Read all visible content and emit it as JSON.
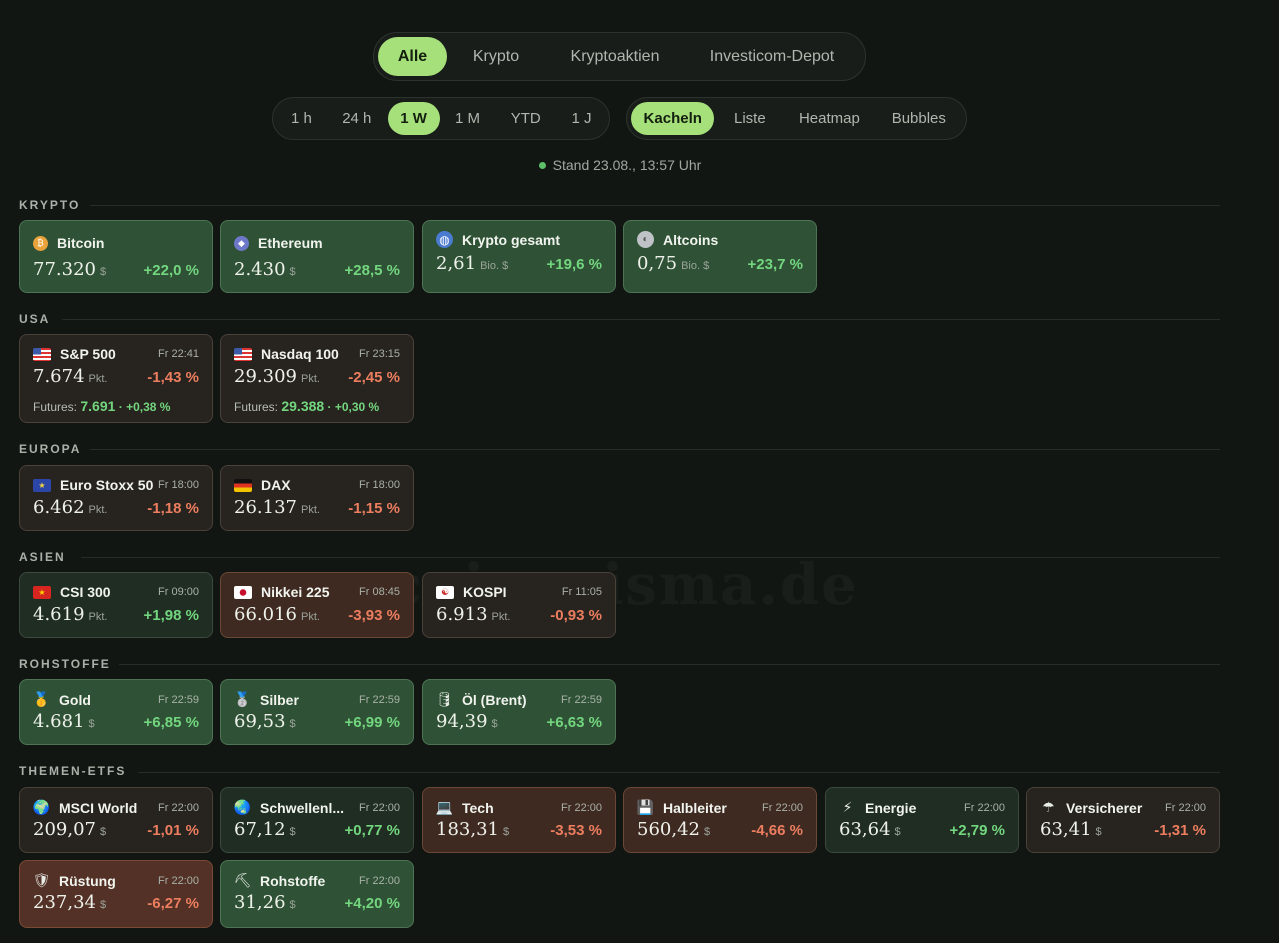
{
  "main_tabs": [
    "Alle",
    "Krypto",
    "Kryptoaktien",
    "Investicom-Depot"
  ],
  "main_tab_active": "Alle",
  "time_tabs": [
    "1 h",
    "24 h",
    "1 W",
    "1 M",
    "YTD",
    "1 J"
  ],
  "time_tab_active": "1 W",
  "view_tabs": [
    "Kacheln",
    "Liste",
    "Heatmap",
    "Bubbles"
  ],
  "view_tab_active": "Kacheln",
  "status": "Stand 23.08., 13:57 Uhr",
  "watermark": "coinprisma.de",
  "colors": {
    "accent": "#a6e07a",
    "positive": "#73d67f",
    "negative": "#ec7e5f",
    "background": "#121613"
  },
  "sections": [
    {
      "label": "KRYPTO",
      "tiles": [
        {
          "name": "Bitcoin",
          "icon": "bitcoin-icon",
          "time": "",
          "price": "77.320",
          "unit": "$",
          "change": "+22,0 %",
          "direction": "up"
        },
        {
          "name": "Ethereum",
          "icon": "ethereum-icon",
          "time": "",
          "price": "2.430",
          "unit": "$",
          "change": "+28,5 %",
          "direction": "up"
        },
        {
          "name": "Krypto gesamt",
          "icon": "globe-icon",
          "time": "",
          "price": "2,61",
          "unit": "Bio. $",
          "change": "+19,6 %",
          "direction": "up"
        },
        {
          "name": "Altcoins",
          "icon": "altcoins-icon",
          "time": "",
          "price": "0,75",
          "unit": "Bio. $",
          "change": "+23,7 %",
          "direction": "up"
        }
      ]
    },
    {
      "label": "USA",
      "tiles": [
        {
          "name": "S&P 500",
          "icon": "us-flag-icon",
          "time": "Fr 22:41",
          "price": "7.674",
          "unit": "Pkt.",
          "change": "-1,43 %",
          "direction": "down",
          "futures_label": "Futures:",
          "futures_value": "7.691",
          "futures_change": "· +0,38 %"
        },
        {
          "name": "Nasdaq 100",
          "icon": "us-flag-icon",
          "time": "Fr 23:15",
          "price": "29.309",
          "unit": "Pkt.",
          "change": "-2,45 %",
          "direction": "down",
          "futures_label": "Futures:",
          "futures_value": "29.388",
          "futures_change": "· +0,30 %"
        }
      ]
    },
    {
      "label": "EUROPA",
      "tiles": [
        {
          "name": "Euro Stoxx 50",
          "icon": "eu-flag-icon",
          "time": "Fr 18:00",
          "price": "6.462",
          "unit": "Pkt.",
          "change": "-1,18 %",
          "direction": "down"
        },
        {
          "name": "DAX",
          "icon": "de-flag-icon",
          "time": "Fr 18:00",
          "price": "26.137",
          "unit": "Pkt.",
          "change": "-1,15 %",
          "direction": "down"
        }
      ]
    },
    {
      "label": "ASIEN",
      "tiles": [
        {
          "name": "CSI 300",
          "icon": "cn-flag-icon",
          "time": "Fr 09:00",
          "price": "4.619",
          "unit": "Pkt.",
          "change": "+1,98 %",
          "direction": "up"
        },
        {
          "name": "Nikkei 225",
          "icon": "jp-flag-icon",
          "time": "Fr 08:45",
          "price": "66.016",
          "unit": "Pkt.",
          "change": "-3,93 %",
          "direction": "down"
        },
        {
          "name": "KOSPI",
          "icon": "kr-flag-icon",
          "time": "Fr 11:05",
          "price": "6.913",
          "unit": "Pkt.",
          "change": "-0,93 %",
          "direction": "down"
        }
      ]
    },
    {
      "label": "ROHSTOFFE",
      "tiles": [
        {
          "name": "Gold",
          "icon": "gold-medal-icon",
          "time": "Fr 22:59",
          "price": "4.681",
          "unit": "$",
          "change": "+6,85 %",
          "direction": "up"
        },
        {
          "name": "Silber",
          "icon": "silver-medal-icon",
          "time": "Fr 22:59",
          "price": "69,53",
          "unit": "$",
          "change": "+6,99 %",
          "direction": "up"
        },
        {
          "name": "Öl (Brent)",
          "icon": "oil-barrel-icon",
          "time": "Fr 22:59",
          "price": "94,39",
          "unit": "$",
          "change": "+6,63 %",
          "direction": "up"
        }
      ]
    },
    {
      "label": "THEMEN-ETFS",
      "tiles": [
        {
          "name": "MSCI World",
          "icon": "globe-americas-icon",
          "time": "Fr 22:00",
          "price": "209,07",
          "unit": "$",
          "change": "-1,01 %",
          "direction": "down"
        },
        {
          "name": "Schwellenl...",
          "icon": "globe-asia-icon",
          "time": "Fr 22:00",
          "price": "67,12",
          "unit": "$",
          "change": "+0,77 %",
          "direction": "up"
        },
        {
          "name": "Tech",
          "icon": "laptop-icon",
          "time": "Fr 22:00",
          "price": "183,31",
          "unit": "$",
          "change": "-3,53 %",
          "direction": "down"
        },
        {
          "name": "Halbleiter",
          "icon": "floppy-disk-icon",
          "time": "Fr 22:00",
          "price": "560,42",
          "unit": "$",
          "change": "-4,66 %",
          "direction": "down"
        },
        {
          "name": "Energie",
          "icon": "lightning-icon",
          "time": "Fr 22:00",
          "price": "63,64",
          "unit": "$",
          "change": "+2,79 %",
          "direction": "up"
        },
        {
          "name": "Versicherer",
          "icon": "umbrella-icon",
          "time": "Fr 22:00",
          "price": "63,41",
          "unit": "$",
          "change": "-1,31 %",
          "direction": "down"
        },
        {
          "name": "Rüstung",
          "icon": "shield-icon",
          "time": "Fr 22:00",
          "price": "237,34",
          "unit": "$",
          "change": "-6,27 %",
          "direction": "down"
        },
        {
          "name": "Rohstoffe",
          "icon": "pickaxe-icon",
          "time": "Fr 22:00",
          "price": "31,26",
          "unit": "$",
          "change": "+4,20 %",
          "direction": "up"
        }
      ]
    }
  ]
}
